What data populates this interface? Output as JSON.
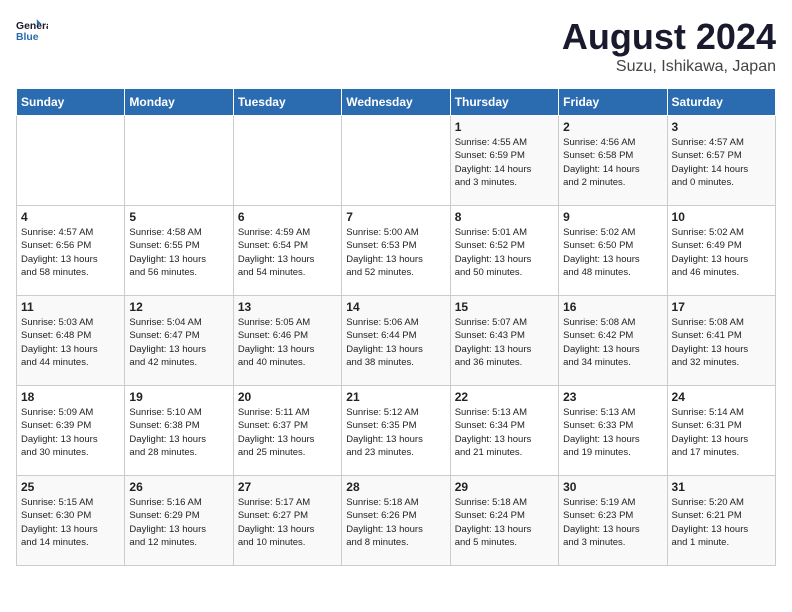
{
  "header": {
    "logo_line1": "General",
    "logo_line2": "Blue",
    "month_title": "August 2024",
    "subtitle": "Suzu, Ishikawa, Japan"
  },
  "days_of_week": [
    "Sunday",
    "Monday",
    "Tuesday",
    "Wednesday",
    "Thursday",
    "Friday",
    "Saturday"
  ],
  "weeks": [
    [
      {
        "day": "",
        "info": ""
      },
      {
        "day": "",
        "info": ""
      },
      {
        "day": "",
        "info": ""
      },
      {
        "day": "",
        "info": ""
      },
      {
        "day": "1",
        "info": "Sunrise: 4:55 AM\nSunset: 6:59 PM\nDaylight: 14 hours\nand 3 minutes."
      },
      {
        "day": "2",
        "info": "Sunrise: 4:56 AM\nSunset: 6:58 PM\nDaylight: 14 hours\nand 2 minutes."
      },
      {
        "day": "3",
        "info": "Sunrise: 4:57 AM\nSunset: 6:57 PM\nDaylight: 14 hours\nand 0 minutes."
      }
    ],
    [
      {
        "day": "4",
        "info": "Sunrise: 4:57 AM\nSunset: 6:56 PM\nDaylight: 13 hours\nand 58 minutes."
      },
      {
        "day": "5",
        "info": "Sunrise: 4:58 AM\nSunset: 6:55 PM\nDaylight: 13 hours\nand 56 minutes."
      },
      {
        "day": "6",
        "info": "Sunrise: 4:59 AM\nSunset: 6:54 PM\nDaylight: 13 hours\nand 54 minutes."
      },
      {
        "day": "7",
        "info": "Sunrise: 5:00 AM\nSunset: 6:53 PM\nDaylight: 13 hours\nand 52 minutes."
      },
      {
        "day": "8",
        "info": "Sunrise: 5:01 AM\nSunset: 6:52 PM\nDaylight: 13 hours\nand 50 minutes."
      },
      {
        "day": "9",
        "info": "Sunrise: 5:02 AM\nSunset: 6:50 PM\nDaylight: 13 hours\nand 48 minutes."
      },
      {
        "day": "10",
        "info": "Sunrise: 5:02 AM\nSunset: 6:49 PM\nDaylight: 13 hours\nand 46 minutes."
      }
    ],
    [
      {
        "day": "11",
        "info": "Sunrise: 5:03 AM\nSunset: 6:48 PM\nDaylight: 13 hours\nand 44 minutes."
      },
      {
        "day": "12",
        "info": "Sunrise: 5:04 AM\nSunset: 6:47 PM\nDaylight: 13 hours\nand 42 minutes."
      },
      {
        "day": "13",
        "info": "Sunrise: 5:05 AM\nSunset: 6:46 PM\nDaylight: 13 hours\nand 40 minutes."
      },
      {
        "day": "14",
        "info": "Sunrise: 5:06 AM\nSunset: 6:44 PM\nDaylight: 13 hours\nand 38 minutes."
      },
      {
        "day": "15",
        "info": "Sunrise: 5:07 AM\nSunset: 6:43 PM\nDaylight: 13 hours\nand 36 minutes."
      },
      {
        "day": "16",
        "info": "Sunrise: 5:08 AM\nSunset: 6:42 PM\nDaylight: 13 hours\nand 34 minutes."
      },
      {
        "day": "17",
        "info": "Sunrise: 5:08 AM\nSunset: 6:41 PM\nDaylight: 13 hours\nand 32 minutes."
      }
    ],
    [
      {
        "day": "18",
        "info": "Sunrise: 5:09 AM\nSunset: 6:39 PM\nDaylight: 13 hours\nand 30 minutes."
      },
      {
        "day": "19",
        "info": "Sunrise: 5:10 AM\nSunset: 6:38 PM\nDaylight: 13 hours\nand 28 minutes."
      },
      {
        "day": "20",
        "info": "Sunrise: 5:11 AM\nSunset: 6:37 PM\nDaylight: 13 hours\nand 25 minutes."
      },
      {
        "day": "21",
        "info": "Sunrise: 5:12 AM\nSunset: 6:35 PM\nDaylight: 13 hours\nand 23 minutes."
      },
      {
        "day": "22",
        "info": "Sunrise: 5:13 AM\nSunset: 6:34 PM\nDaylight: 13 hours\nand 21 minutes."
      },
      {
        "day": "23",
        "info": "Sunrise: 5:13 AM\nSunset: 6:33 PM\nDaylight: 13 hours\nand 19 minutes."
      },
      {
        "day": "24",
        "info": "Sunrise: 5:14 AM\nSunset: 6:31 PM\nDaylight: 13 hours\nand 17 minutes."
      }
    ],
    [
      {
        "day": "25",
        "info": "Sunrise: 5:15 AM\nSunset: 6:30 PM\nDaylight: 13 hours\nand 14 minutes."
      },
      {
        "day": "26",
        "info": "Sunrise: 5:16 AM\nSunset: 6:29 PM\nDaylight: 13 hours\nand 12 minutes."
      },
      {
        "day": "27",
        "info": "Sunrise: 5:17 AM\nSunset: 6:27 PM\nDaylight: 13 hours\nand 10 minutes."
      },
      {
        "day": "28",
        "info": "Sunrise: 5:18 AM\nSunset: 6:26 PM\nDaylight: 13 hours\nand 8 minutes."
      },
      {
        "day": "29",
        "info": "Sunrise: 5:18 AM\nSunset: 6:24 PM\nDaylight: 13 hours\nand 5 minutes."
      },
      {
        "day": "30",
        "info": "Sunrise: 5:19 AM\nSunset: 6:23 PM\nDaylight: 13 hours\nand 3 minutes."
      },
      {
        "day": "31",
        "info": "Sunrise: 5:20 AM\nSunset: 6:21 PM\nDaylight: 13 hours\nand 1 minute."
      }
    ]
  ]
}
